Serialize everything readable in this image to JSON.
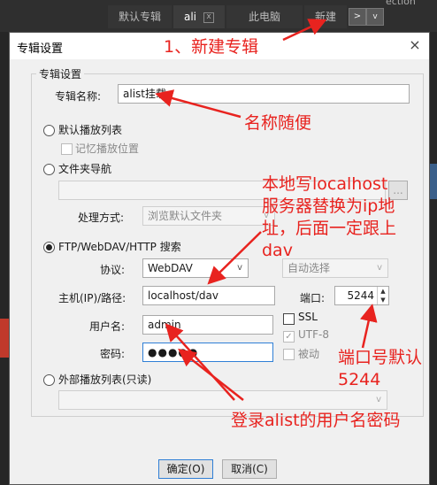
{
  "background": {
    "tabs": [
      "默认专辑",
      "ali",
      "此电脑",
      "新建"
    ],
    "corner_text": "ection",
    "tab_nav": ">",
    "tab_menu": "v"
  },
  "dialog": {
    "title": "专辑设置",
    "close": "×",
    "group_title": "专辑设置",
    "name_label": "专辑名称:",
    "name_value": "alist挂载",
    "default_list": {
      "label": "默认播放列表",
      "remember_pos": "记忆播放位置"
    },
    "folder_nav": {
      "label": "文件夹导航",
      "browse": "...",
      "handling_label": "处理方式:",
      "handling_value": "浏览默认文件夹"
    },
    "ftp": {
      "label": "FTP/WebDAV/HTTP 搜索",
      "protocol_label": "协议:",
      "protocol_value": "WebDAV",
      "encoding_value": "自动选择",
      "host_label": "主机(IP)/路径:",
      "host_value": "localhost/dav",
      "port_label": "端口:",
      "port_value": "5244",
      "ssl": "SSL",
      "utf8": "UTF-8",
      "passive": "被动",
      "user_label": "用户名:",
      "user_value": "admin",
      "pass_label": "密码:",
      "pass_value": "●●●●●"
    },
    "external": {
      "label": "外部播放列表(只读)"
    },
    "ok": "确定(O)",
    "cancel": "取消(C)"
  },
  "annotations": {
    "a1": "1、新建专辑",
    "a2": "名称随便",
    "a3": [
      "本地写localhost",
      "服务器替换为ip地",
      "址，后面一定跟上",
      "dav"
    ],
    "a4": [
      "端口号默认",
      "5244"
    ],
    "a5": "登录alist的用户名密码"
  },
  "colors": {
    "annotation": "#e8231f",
    "focus": "#2f7fd6"
  }
}
